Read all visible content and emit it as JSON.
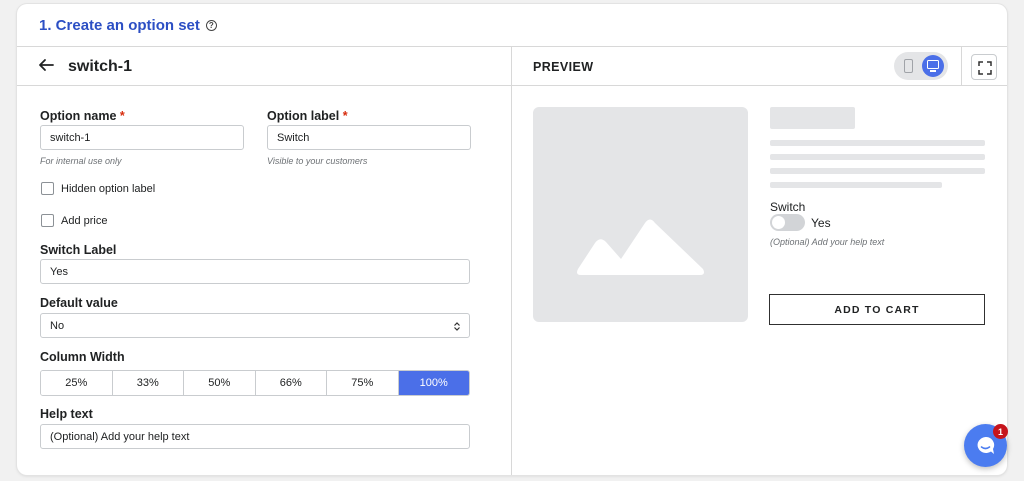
{
  "header": {
    "step_title": "1. Create an option set"
  },
  "editor": {
    "title": "switch-1",
    "option_name": {
      "label": "Option name",
      "required": "*",
      "value": "switch-1",
      "hint": "For internal use only"
    },
    "option_label": {
      "label": "Option label",
      "required": "*",
      "value": "Switch",
      "hint": "Visible to your customers"
    },
    "hidden_option_label": "Hidden option label",
    "add_price": "Add price",
    "switch_label": {
      "label": "Switch Label",
      "value": "Yes"
    },
    "default_value": {
      "label": "Default value",
      "selected": "No"
    },
    "column_width": {
      "label": "Column Width",
      "options": [
        "25%",
        "33%",
        "50%",
        "66%",
        "75%",
        "100%"
      ],
      "selected": "100%"
    },
    "help_text": {
      "label": "Help text",
      "value": "(Optional) Add your help text"
    }
  },
  "preview": {
    "title": "PREVIEW",
    "switch_label": "Switch",
    "switch_value": "Yes",
    "help_text": "(Optional) Add your help text",
    "add_to_cart": "ADD TO CART"
  },
  "chat": {
    "badge_count": "1"
  },
  "colors": {
    "accent": "#4b6fe8",
    "title_blue": "#2c4fc4",
    "required": "#d72c0d",
    "badge": "#c6141c"
  },
  "icons": [
    "help-circle-icon",
    "arrow-left-icon",
    "mobile-icon",
    "desktop-icon",
    "fullscreen-icon",
    "image-placeholder-icon",
    "chat-icon"
  ]
}
